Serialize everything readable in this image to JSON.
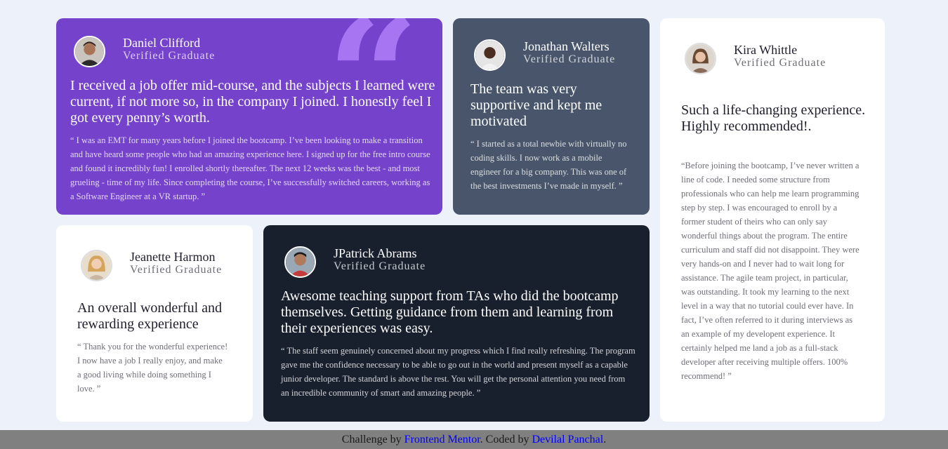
{
  "testimonials": [
    {
      "name": "Daniel Clifford",
      "role": "Verified Graduate",
      "headline": "I received a job offer mid-course, and the subjects I learned were current, if not more so, in the company I joined. I honestly feel I got every penny’s worth.",
      "body": "“ I was an EMT for many years before I joined the bootcamp. I’ve been looking to make a transition and have heard some people who had an amazing experience here. I signed up for the free intro course and found it incredibly fun! I enrolled shortly thereafter. The next 12 weeks was the best - and most grueling - time of my life. Since completing the course, I’ve successfully switched careers, working as a Software Engineer at a VR startup. ”"
    },
    {
      "name": "Jonathan Walters",
      "role": "Verified Graduate",
      "headline": "The team was very supportive and kept me motivated",
      "body": "“ I started as a total newbie with virtually no coding skills. I now work as a mobile engineer for a big company. This was one of the best investments I’ve made in myself. ”"
    },
    {
      "name": "Kira Whittle",
      "role": "Verified Graduate",
      "headline": "Such a life-changing experience. Highly recommended!.",
      "body": "“Before joining the bootcamp, I’ve never written a line of code. I needed some structure from professionals who can help me learn programming step by step. I was encouraged to enroll by a former student of theirs who can only say wonderful things about the program. The entire curriculum and staff did not disappoint. They were very hands-on and I never had to wait long for assistance. The agile team project, in particular, was outstanding. It took my learning to the next level in a way that no tutorial could ever have. In fact, I’ve often referred to it during interviews as an example of my developent experience. It certainly helped me land a job as a full-stack developer after receiving multiple offers. 100% recommend! ”"
    },
    {
      "name": "Jeanette Harmon",
      "role": "Verified Graduate",
      "headline": "An overall wonderful and rewarding experience",
      "body": "“ Thank you for the wonderful experience! I now have a job I really enjoy, and make a good living while doing something I love. ”"
    },
    {
      "name": "JPatrick Abrams",
      "role": "Verified Graduate",
      "headline": "Awesome teaching support from TAs who did the bootcamp themselves. Getting guidance from them and learning from their experiences was easy.",
      "body": "“ The staff seem genuinely concerned about my progress which I find really refreshing. The program gave me the confidence necessary to be able to go out in the world and present myself as a capable junior developer. The standard is above the rest. You will get the personal attention you need from an incredible community of smart and amazing people. ”"
    }
  ],
  "quote_icon": "quotation-mark-icon",
  "footer": {
    "prefix": "Challenge by ",
    "mentor_link": "Frontend Mentor",
    "middle": ". Coded by ",
    "author_link": "Devilal Panchal",
    "suffix": "."
  },
  "colors": {
    "purple": "#7542cc",
    "grayish_blue": "#48556a",
    "dark_blue": "#19202d",
    "white": "#ffffff",
    "background": "#edf1f9",
    "footer": "#808080",
    "link": "#0000ff"
  }
}
